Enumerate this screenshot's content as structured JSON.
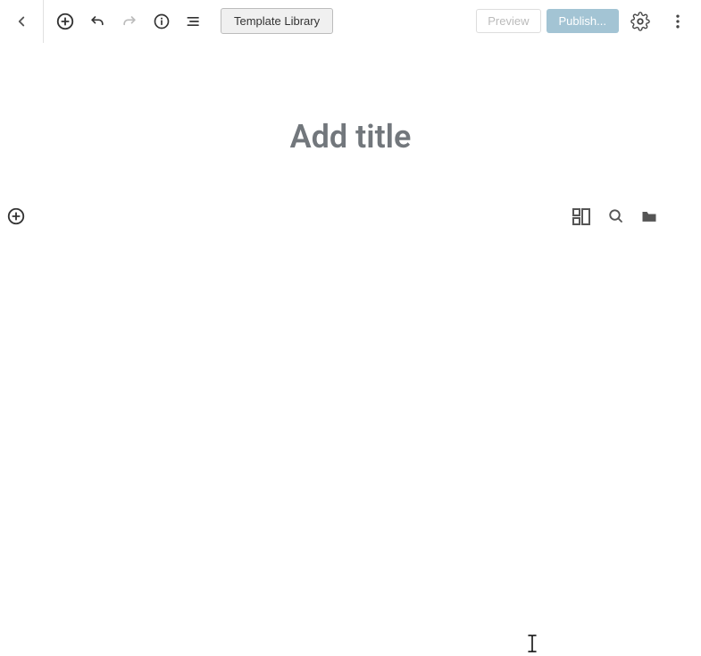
{
  "toolbar": {
    "template_library": "Template Library",
    "preview": "Preview",
    "publish": "Publish..."
  },
  "editor": {
    "title_placeholder": "Add title"
  }
}
